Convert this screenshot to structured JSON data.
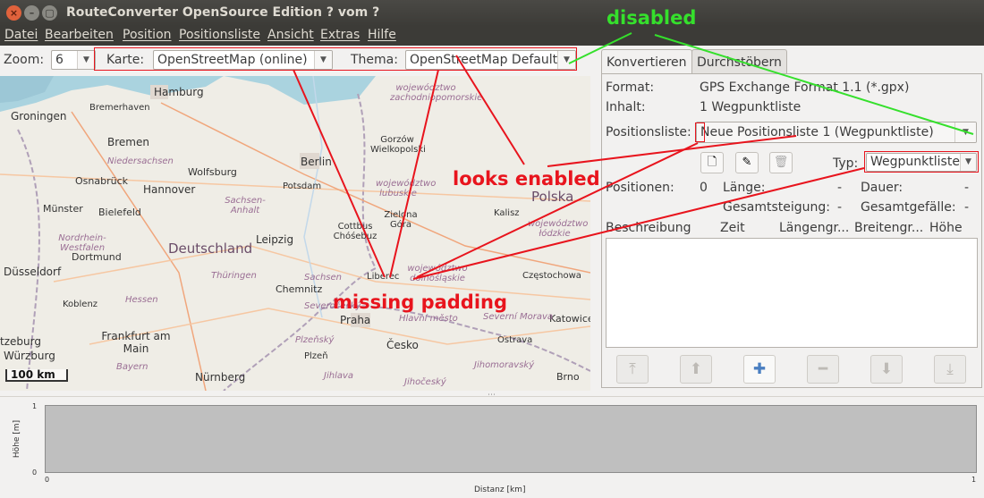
{
  "window": {
    "title": "RouteConverter OpenSource Edition ? vom ?",
    "close_glyph": "×",
    "min_glyph": "–",
    "max_glyph": "▢"
  },
  "menu": [
    "Datei",
    "Bearbeiten",
    "Position",
    "Positionsliste",
    "Ansicht",
    "Extras",
    "Hilfe"
  ],
  "toolbar": {
    "zoom_label": "Zoom:",
    "zoom_value": "6",
    "map_label": "Karte:",
    "map_value": "OpenStreetMap (online)",
    "theme_label": "Thema:",
    "theme_value": "OpenStreetMap Default"
  },
  "map": {
    "cities": [
      "Hamburg",
      "Bremerhaven",
      "Groningen",
      "Bremen",
      "Osnabrück",
      "Wolfsburg",
      "Hannover",
      "Berlin",
      "Potsdam",
      "Gorzów Wielkopolski",
      "Münster",
      "Bielefeld",
      "Dortmund",
      "Leipzig",
      "Cottbus Chóśebuz",
      "Zielona Góra",
      "Kalisz",
      "Düsseldorf",
      "Koblenz",
      "Chemnitz",
      "Liberec",
      "Praha",
      "Frankfurt am Main",
      "Plzeň",
      "Ostrava",
      "Częstochowa",
      "Katowice",
      "Würzburg",
      "Nürnberg",
      "Brno",
      "Česko",
      "Deutschland",
      "Polska"
    ],
    "regions": [
      "Niedersachsen",
      "Sachsen-Anhalt",
      "Nordrhein-Westfalen",
      "Hessen",
      "Thüringen",
      "Sachsen",
      "województwo zachodniopomorskie",
      "województwo lubuskie",
      "województwo łódzkie",
      "województwo dolnośląskie",
      "Severočeský",
      "Jihočeský",
      "Plzeňský",
      "Bayern",
      "Jihomoravský",
      "Severní Morava",
      "Jihlava",
      "Hlavní město"
    ],
    "scale_text": "100 km",
    "scale_left_label": "tzeburg"
  },
  "tabs": [
    "Konvertieren",
    "Durchstöbern"
  ],
  "panel": {
    "format_label": "Format:",
    "format_value": "GPS Exchange Format 1.1 (*.gpx)",
    "content_label": "Inhalt:",
    "content_value": "1 Wegpunktliste",
    "list_label": "Positionsliste:",
    "list_value": "Neue Positionsliste 1 (Wegpunktliste)",
    "type_label": "Typ:",
    "type_value": "Wegpunktliste",
    "positions_label": "Positionen:",
    "positions_value": "0",
    "length_label": "Länge:",
    "length_value": "-",
    "duration_label": "Dauer:",
    "duration_value": "-",
    "ascent_label": "Gesamtsteigung:",
    "ascent_value": "-",
    "descent_label": "Gesamtgefälle:",
    "descent_value": "-"
  },
  "table": {
    "columns": [
      "Beschreibung",
      "Zeit",
      "Längengr...",
      "Breitengr...",
      "Höhe"
    ]
  },
  "nav_buttons": [
    {
      "icon": "move-top-icon",
      "glyph": "⤒",
      "enabled": false
    },
    {
      "icon": "move-up-icon",
      "glyph": "⬆",
      "enabled": false
    },
    {
      "icon": "add-icon",
      "glyph": "✚",
      "enabled": true
    },
    {
      "icon": "remove-icon",
      "glyph": "━",
      "enabled": false
    },
    {
      "icon": "move-down-icon",
      "glyph": "⬇",
      "enabled": false
    },
    {
      "icon": "move-bottom-icon",
      "glyph": "⤓",
      "enabled": false
    }
  ],
  "profile": {
    "y_label": "Höhe [m]",
    "x_label": "Distanz [km]",
    "y_max": "1",
    "y_min": "0",
    "x_min": "0",
    "x_max": "1",
    "drag_handle": "⋯"
  },
  "annotations": {
    "disabled": "disabled",
    "looks_enabled": "looks enabled",
    "missing_padding": "missing padding"
  },
  "colors": {
    "annotation_green": "#35e02c",
    "annotation_red": "#e8141d",
    "accent_blue": "#4a7fc1"
  }
}
